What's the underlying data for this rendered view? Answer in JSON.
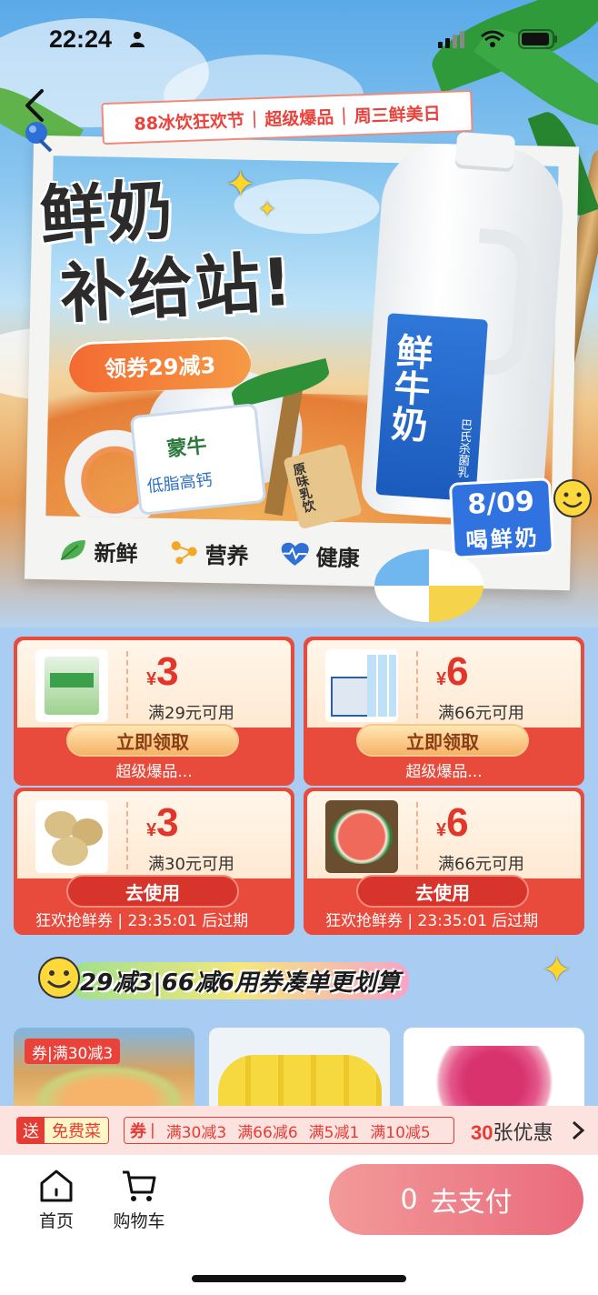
{
  "status_bar": {
    "time": "22:24"
  },
  "banner": {
    "ribbon": [
      "88冰饮狂欢节",
      "超级爆品",
      "周三鲜美日"
    ],
    "headline_line1": "鲜奶",
    "headline_line2": "补给站!",
    "coupon_pill": "领券29减3",
    "jug_label": "鲜牛奶",
    "jug_sub": "巴氏杀菌乳",
    "yogurt_brand": "蒙牛",
    "yogurt_sub": "低脂高钙",
    "snack_label": "原味乳饮",
    "date_badge": {
      "date": "8/09",
      "text": "喝鲜奶"
    },
    "features": [
      {
        "label": "新鲜",
        "icon": "leaf-icon"
      },
      {
        "label": "营养",
        "icon": "molecule-icon"
      },
      {
        "label": "健康",
        "icon": "heart-pulse-icon"
      }
    ]
  },
  "coupons": [
    {
      "currency": "¥",
      "amount": "3",
      "condition": "满29元可用",
      "action": "立即领取",
      "footer": "超级爆品...",
      "image": "milk-box-image"
    },
    {
      "currency": "¥",
      "amount": "6",
      "condition": "满66元可用",
      "action": "立即领取",
      "footer": "超级爆品...",
      "image": "water-bottles-image"
    },
    {
      "currency": "¥",
      "amount": "3",
      "condition": "满30元可用",
      "action": "去使用",
      "footer": "狂欢抢鲜券 | 23:35:01 后过期",
      "image": "potatoes-image"
    },
    {
      "currency": "¥",
      "amount": "6",
      "condition": "满66元可用",
      "action": "去使用",
      "footer": "狂欢抢鲜券 | 23:35:01 后过期",
      "image": "watermelon-image"
    }
  ],
  "promo_strip": {
    "text": "29减3|66减6用券凑单更划算"
  },
  "products": [
    {
      "tag": "券|满30减3",
      "image": "melon-image"
    },
    {
      "tag": "",
      "image": "bananas-image"
    },
    {
      "tag": "",
      "image": "dragonfruit-image"
    }
  ],
  "discount_bar": {
    "send_label": "送",
    "send_value": "免费菜",
    "quan_label": "券",
    "items": [
      "满30减3",
      "满66减6",
      "满5减1",
      "满10减5"
    ],
    "count": "30",
    "count_suffix": "张优惠"
  },
  "bottom_bar": {
    "home_label": "首页",
    "cart_label": "购物车",
    "pay_count": "0",
    "pay_label": "去支付"
  },
  "colors": {
    "accent_red": "#e84a3b",
    "pay_gradient_start": "#f29a9a",
    "pay_gradient_end": "#ea6b7c",
    "sky_blue": "#a9cdf2"
  }
}
